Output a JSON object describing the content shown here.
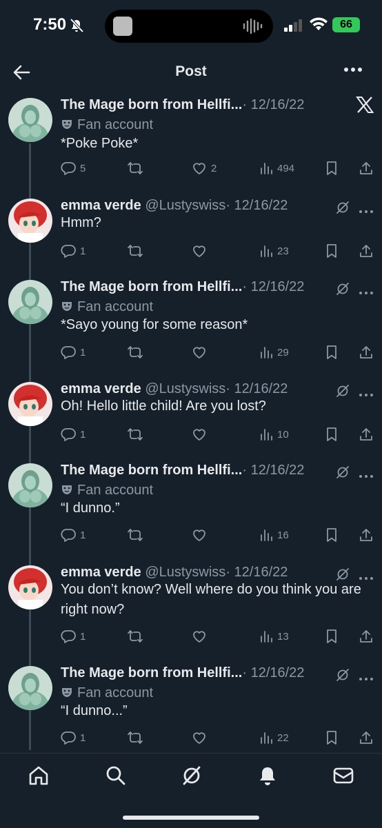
{
  "status": {
    "time": "7:50",
    "battery": "66"
  },
  "header": {
    "title": "Post"
  },
  "tweets": [
    {
      "name": "The Mage born from Hellfi...",
      "date": "· 12/16/22",
      "fan": "Fan account",
      "text": "*Poke Poke*",
      "replies": "5",
      "likes": "2",
      "views": "494"
    },
    {
      "name": "emma verde",
      "handle": "@Lustyswiss",
      "date": "· 12/16/22",
      "text": "Hmm?",
      "replies": "1",
      "views": "23"
    },
    {
      "name": "The Mage born from Hellfi...",
      "date": "· 12/16/22",
      "fan": "Fan account",
      "text": "*Sayo young for some reason*",
      "replies": "1",
      "views": "29"
    },
    {
      "name": "emma verde",
      "handle": "@Lustyswiss",
      "date": "· 12/16/22",
      "text": "Oh! Hello little child! Are you lost?",
      "replies": "1",
      "views": "10"
    },
    {
      "name": "The Mage born from Hellfi...",
      "date": "· 12/16/22",
      "fan": "Fan account",
      "text": "“I dunno.”",
      "replies": "1",
      "views": "16"
    },
    {
      "name": "emma verde",
      "handle": "@Lustyswiss",
      "date": "· 12/16/22",
      "text": "You don’t know? Well where do you think you are right now?",
      "replies": "1",
      "views": "13"
    },
    {
      "name": "The Mage born from Hellfi...",
      "date": "· 12/16/22",
      "fan": "Fan account",
      "text": "“I dunno...”",
      "replies": "1",
      "views": "22"
    }
  ],
  "icons": [
    "back-arrow-icon",
    "more-icon",
    "x-logo-icon",
    "grok-icon",
    "reply-icon",
    "repost-icon",
    "like-icon",
    "views-icon",
    "bookmark-icon",
    "share-icon",
    "home-icon",
    "search-icon",
    "notifications-icon",
    "messages-icon",
    "theater-masks-icon"
  ],
  "colors": {
    "background": "#15202b",
    "muted": "#8b98a5",
    "text": "#e7e9ea",
    "battery": "#34c759"
  }
}
